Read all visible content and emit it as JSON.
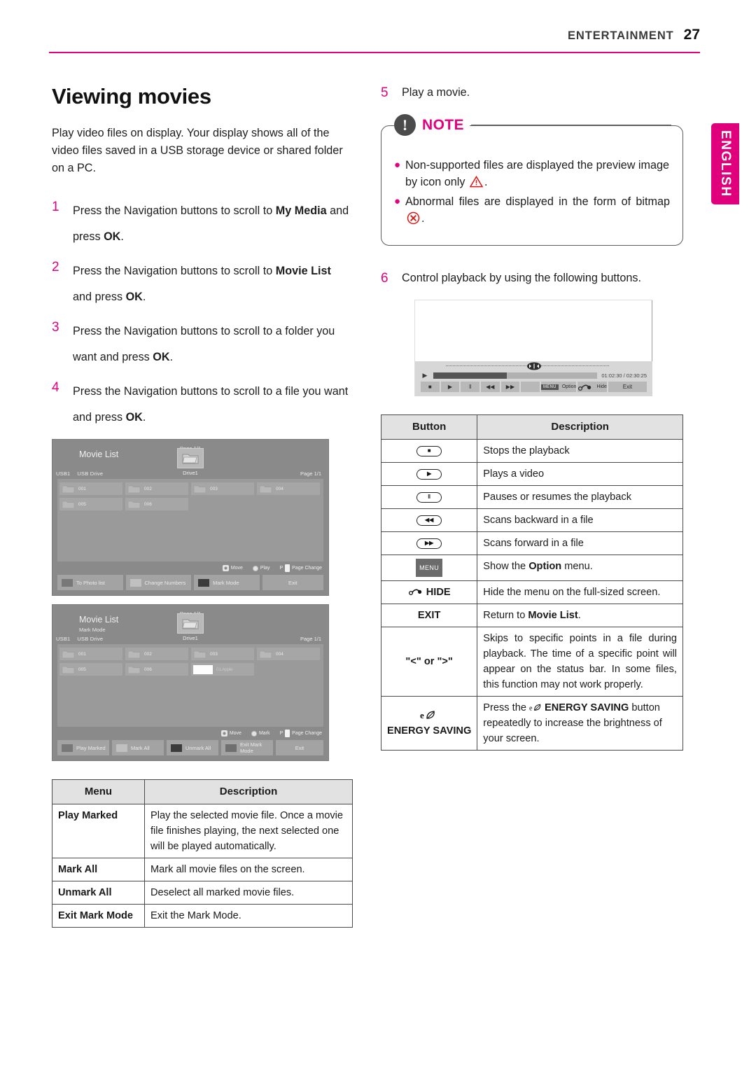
{
  "header": {
    "section": "ENTERTAINMENT",
    "page_number": "27",
    "rule_color": "#e5007e"
  },
  "language_tab": {
    "label": "ENGLISH",
    "color": "#e0007c"
  },
  "left_column": {
    "title": "Viewing movies",
    "intro": "Play video files on display. Your display shows all of the video files saved in a USB storage device or shared folder on a PC.",
    "steps": [
      {
        "num": "1",
        "parts": [
          {
            "t": "Press the Navigation buttons to scroll to ",
            "b": false
          },
          {
            "t": "My Media",
            "b": true
          },
          {
            "t": " and press ",
            "b": false
          },
          {
            "t": "OK",
            "b": true
          },
          {
            "t": ".",
            "b": false
          }
        ]
      },
      {
        "num": "2",
        "parts": [
          {
            "t": "Press the Navigation buttons to scroll to ",
            "b": false
          },
          {
            "t": "Movie List",
            "b": true
          },
          {
            "t": " and press ",
            "b": false
          },
          {
            "t": "OK",
            "b": true
          },
          {
            "t": ".",
            "b": false
          }
        ]
      },
      {
        "num": "3",
        "parts": [
          {
            "t": "Press the Navigation buttons to scroll to a folder you want and press ",
            "b": false
          },
          {
            "t": "OK",
            "b": true
          },
          {
            "t": ".",
            "b": false
          }
        ]
      },
      {
        "num": "4",
        "parts": [
          {
            "t": "Press the Navigation buttons to scroll to a file you want and press ",
            "b": false
          },
          {
            "t": "OK",
            "b": true
          },
          {
            "t": ".",
            "b": false
          }
        ]
      }
    ]
  },
  "movie_list_screen": {
    "title": "Movie List",
    "usb_slot": "USB1",
    "usb_name": "USB Drive",
    "page_top": "Page 1/1",
    "page_right": "Page 1/1",
    "drive_label": "Drive1",
    "cells": [
      {
        "label": "001",
        "type": "folder"
      },
      {
        "label": "002",
        "type": "folder"
      },
      {
        "label": "003",
        "type": "folder"
      },
      {
        "label": "004",
        "type": "folder"
      },
      {
        "label": "005",
        "type": "folder"
      },
      {
        "label": "006",
        "type": "folder"
      }
    ],
    "hints": [
      {
        "icon": "dpad-icon",
        "label": "Move"
      },
      {
        "icon": "ok-circle-icon",
        "label": "Play"
      },
      {
        "prefix": "P",
        "icon": "page-key-icon",
        "label": "Page Change"
      }
    ],
    "footer_buttons": [
      {
        "label": "To Photo list",
        "chip": "gray"
      },
      {
        "label": "Change Numbers",
        "chip": "light"
      },
      {
        "label": "Mark Mode",
        "chip": "dark"
      },
      {
        "label": "Exit",
        "chip": "none"
      }
    ]
  },
  "mark_mode_screen": {
    "title": "Movie List",
    "submode": "Mark Mode",
    "usb_slot": "USB1",
    "usb_name": "USB Drive",
    "page_top": "Page 1/1",
    "page_right": "Page 1/1",
    "drive_label": "Drive1",
    "cells": [
      {
        "label": "001",
        "type": "folder"
      },
      {
        "label": "002",
        "type": "folder"
      },
      {
        "label": "003",
        "type": "folder"
      },
      {
        "label": "004",
        "type": "folder"
      },
      {
        "label": "005",
        "type": "folder"
      },
      {
        "label": "006",
        "type": "folder"
      },
      {
        "label": "01.Apple",
        "type": "thumbnail"
      }
    ],
    "hints": [
      {
        "icon": "dpad-icon",
        "label": "Move"
      },
      {
        "icon": "ok-circle-icon",
        "label": "Mark"
      },
      {
        "prefix": "P",
        "icon": "page-key-icon",
        "label": "Page Change"
      }
    ],
    "footer_buttons": [
      {
        "label": "Play Marked",
        "chip": "gray"
      },
      {
        "label": "Mark All",
        "chip": "light"
      },
      {
        "label": "Unmark All",
        "chip": "dark"
      },
      {
        "label": "Exit Mark Mode",
        "chip": "mid"
      },
      {
        "label": "Exit",
        "chip": "none"
      }
    ]
  },
  "menu_table": {
    "headers": [
      "Menu",
      "Description"
    ],
    "rows": [
      {
        "menu": "Play Marked",
        "description": "Play the selected movie file. Once a movie file finishes playing, the next selected one will be played automatically."
      },
      {
        "menu": "Mark All",
        "description": "Mark all movie files on the screen."
      },
      {
        "menu": "Unmark All",
        "description": "Deselect all marked movie files."
      },
      {
        "menu": "Exit Mark Mode",
        "description": "Exit the Mark Mode."
      }
    ]
  },
  "right_column": {
    "step5": {
      "num": "5",
      "text": "Play a movie."
    },
    "step6": {
      "num": "6",
      "text": "Control playback by using the following buttons."
    },
    "note": {
      "label": "NOTE",
      "badge": "!",
      "items": [
        {
          "pre": "Non-supported files are displayed the preview image by icon only ",
          "icon": "warning-triangle-icon",
          "post": "."
        },
        {
          "pre": "Abnormal files are displayed in the form of bitmap ",
          "icon": "x-circle-icon",
          "post": "."
        }
      ]
    }
  },
  "playback_screen": {
    "time_elapsed": "01:02:30",
    "time_total": "02:30:25",
    "time_display": "01:02:30 / 02:30:25",
    "progress_percent": 45,
    "keys": [
      {
        "name": "stop",
        "glyph": "■"
      },
      {
        "name": "play",
        "glyph": "▶"
      },
      {
        "name": "pause",
        "glyph": "‖"
      },
      {
        "name": "rewind",
        "glyph": "◀◀"
      },
      {
        "name": "fast-forward",
        "glyph": "▶▶"
      }
    ],
    "menu_label": "MENU",
    "option_label": "Option",
    "hide_label": "Hide",
    "exit_label": "Exit"
  },
  "button_table": {
    "headers": [
      "Button",
      "Description"
    ],
    "rows": [
      {
        "button_type": "pill",
        "glyph": "■",
        "name": "stop-button",
        "description": "Stops the playback",
        "bold_part": ""
      },
      {
        "button_type": "pill",
        "glyph": "▶",
        "name": "play-button",
        "description": "Plays a video",
        "bold_part": ""
      },
      {
        "button_type": "pill",
        "glyph": "‖",
        "name": "pause-button",
        "description": "Pauses or resumes the playback",
        "bold_part": ""
      },
      {
        "button_type": "pill",
        "glyph": "◀◀",
        "name": "rewind-button",
        "description": "Scans backward in a file",
        "bold_part": ""
      },
      {
        "button_type": "pill",
        "glyph": "▶▶",
        "name": "forward-button",
        "description": "Scans forward in a file",
        "bold_part": ""
      },
      {
        "button_type": "badge",
        "glyph": "MENU",
        "name": "menu-button",
        "description_pre": "Show the ",
        "bold_part": "Option",
        "description_post": " menu."
      },
      {
        "button_type": "hide",
        "glyph": "HIDE",
        "name": "hide-button",
        "description": "Hide the menu on the full-sized screen.",
        "bold_part": ""
      },
      {
        "button_type": "text",
        "glyph": "EXIT",
        "name": "exit-button",
        "description_pre": "Return to ",
        "bold_part": "Movie List",
        "description_post": "."
      },
      {
        "button_type": "text",
        "glyph": "\"<\" or \">\"",
        "name": "skip-buttons",
        "description": "Skips to specific points in a file during playback. The time of a specific point will appear on the status bar. In some files, this function may not work properly.",
        "bold_part": ""
      },
      {
        "button_type": "energy",
        "glyph": "ENERGY SAVING",
        "name": "energy-saving-button",
        "description_pre": "Press the ",
        "bold_part": "ENERGY SAVING",
        "description_post": " button repeatedly to increase the brightness of your screen."
      }
    ]
  }
}
